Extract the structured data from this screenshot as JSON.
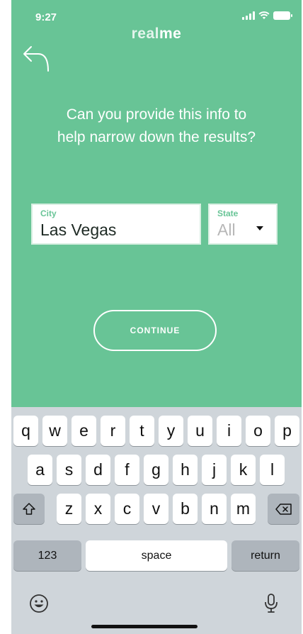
{
  "status_bar": {
    "time": "9:27"
  },
  "brand": {
    "logo_light": "real",
    "logo_bold": "me"
  },
  "prompt": {
    "line1": "Can you provide this info to",
    "line2": "help narrow down the results?"
  },
  "form": {
    "city_label": "City",
    "city_value": "Las Vegas",
    "state_label": "State",
    "state_value": "All"
  },
  "actions": {
    "continue_label": "CONTINUE"
  },
  "colors": {
    "background": "#68c496",
    "keyboard": "#cfd5da"
  },
  "keyboard": {
    "row1": [
      "q",
      "w",
      "e",
      "r",
      "t",
      "y",
      "u",
      "i",
      "o",
      "p"
    ],
    "row2": [
      "a",
      "s",
      "d",
      "f",
      "g",
      "h",
      "j",
      "k",
      "l"
    ],
    "row3": [
      "z",
      "x",
      "c",
      "v",
      "b",
      "n",
      "m"
    ],
    "numbers_label": "123",
    "space_label": "space",
    "return_label": "return",
    "icons": [
      "shift-icon",
      "backspace-icon",
      "emoji-icon",
      "microphone-icon"
    ]
  }
}
